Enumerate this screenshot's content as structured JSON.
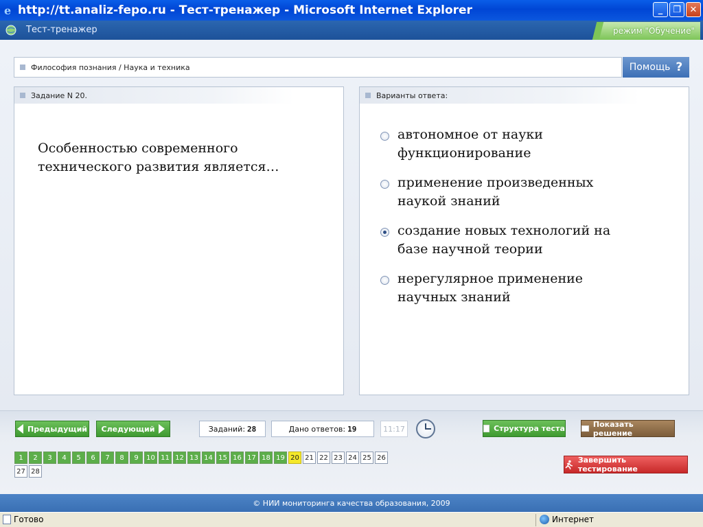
{
  "window": {
    "title": "http://tt.analiz-fepo.ru - Тест-тренажер - Microsoft Internet Explorer",
    "minimize": "_",
    "maximize": "❐",
    "close": "✕"
  },
  "header": {
    "app_title": "Тест-тренажер",
    "mode": "режим \"Обучение\""
  },
  "breadcrumb": "Философия познания / Наука и техника",
  "help": {
    "label": "Помощь",
    "glyph": "?"
  },
  "question_panel": {
    "heading": "Задание N 20.",
    "text": "Особенностью современного технического развития является…"
  },
  "answers_panel": {
    "heading": "Варианты ответа:",
    "options": [
      {
        "text": "автономное от науки функционирование",
        "selected": false
      },
      {
        "text": "применение произведенных наукой знаний",
        "selected": false
      },
      {
        "text": "создание новых технологий на базе научной теории",
        "selected": true
      },
      {
        "text": "нерегулярное применение научных знаний",
        "selected": false
      }
    ]
  },
  "nav": {
    "prev": "Предыдущий",
    "next": "Следующий",
    "tasks_label": "Заданий:",
    "tasks_value": "28",
    "answered_label": "Дано ответов:",
    "answered_value": "19",
    "timer": "11:17",
    "structure": "Структура теста",
    "show_solution": "Показать решение",
    "finish": "Завершить тестирование"
  },
  "question_numbers": {
    "answered": [
      "1",
      "2",
      "3",
      "4",
      "5",
      "6",
      "7",
      "8",
      "9",
      "10",
      "11",
      "12",
      "13",
      "14",
      "15",
      "16",
      "17",
      "18",
      "19"
    ],
    "current": "20",
    "remaining": [
      "21",
      "22",
      "23",
      "24",
      "25",
      "26",
      "27",
      "28"
    ]
  },
  "footer": "© НИИ мониторинга качества образования, 2009",
  "status": {
    "left": "Готово",
    "right": "Интернет"
  },
  "colors": {
    "title_blue": "#0046d5",
    "header_blue": "#2b66b0",
    "green": "#5cae4a",
    "current_yellow": "#f5e82a",
    "finish_red": "#c72929"
  }
}
